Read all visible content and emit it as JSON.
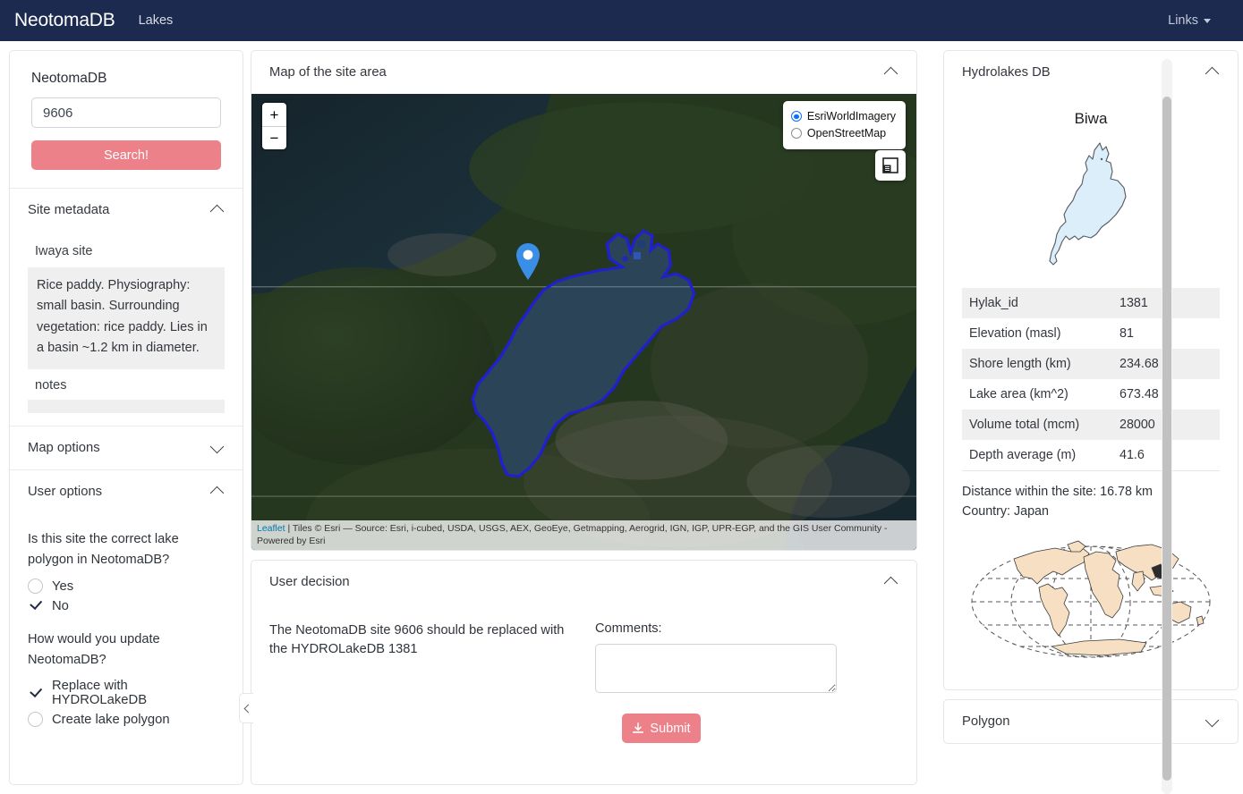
{
  "navbar": {
    "brand": "NeotomaDB",
    "nav_item": "Lakes",
    "links_label": "Links"
  },
  "sidebar": {
    "search": {
      "label": "NeotomaDB",
      "value": "9606",
      "placeholder": "",
      "button": "Search!"
    },
    "site_metadata": {
      "title": "Site metadata",
      "site_name": "Iwaya site",
      "description": "Rice paddy. Physiography: small basin. Surrounding vegetation: rice paddy. Lies in a basin ~1.2 km in diameter.",
      "notes_label": "notes",
      "notes_value": ""
    },
    "map_options": {
      "title": "Map options"
    },
    "user_options": {
      "title": "User options",
      "question1": "Is this site the correct lake polygon in NeotomaDB?",
      "options1": [
        {
          "label": "Yes",
          "selected": false
        },
        {
          "label": "No",
          "selected": true
        }
      ],
      "question2": "How would you update NeotomaDB?",
      "options2": [
        {
          "label": "Replace with HYDROLakeDB",
          "selected": true
        },
        {
          "label": "Create lake polygon",
          "selected": false
        }
      ]
    }
  },
  "map_panel": {
    "title": "Map of the site area",
    "zoom_in": "+",
    "zoom_out": "−",
    "layers": [
      {
        "label": "EsriWorldImagery",
        "selected": true
      },
      {
        "label": "OpenStreetMap",
        "selected": false
      }
    ],
    "attribution_link": "Leaflet",
    "attribution_text": " | Tiles © Esri — Source: Esri, i-cubed, USDA, USGS, AEX, GeoEye, Getmapping, Aerogrid, IGN, IGP, UPR-EGP, and the GIS User Community - Powered by Esri"
  },
  "decision_panel": {
    "title": "User decision",
    "statement": "The NeotomaDB site 9606 should be replaced with the HYDROLakeDB 1381",
    "comments_label": "Comments:",
    "comments_value": "",
    "comments_placeholder": "",
    "submit_label": "Submit"
  },
  "hydrolakes": {
    "title": "Hydrolakes DB",
    "lake_name": "Biwa",
    "properties": [
      {
        "key": "Hylak_id",
        "value": "1381"
      },
      {
        "key": "Elevation (masl)",
        "value": "81"
      },
      {
        "key": "Shore length (km)",
        "value": "234.68"
      },
      {
        "key": "Lake area (km^2)",
        "value": "673.48"
      },
      {
        "key": "Volume total (mcm)",
        "value": "28000"
      },
      {
        "key": "Depth average (m)",
        "value": "41.6"
      }
    ],
    "distance": "Distance within the site: 16.78 km",
    "country": "Country: Japan"
  },
  "polygon_panel": {
    "title": "Polygon"
  },
  "colors": {
    "navbar": "#1b2a4e",
    "accent": "#ed8189",
    "lake_fill": "#ddeefb",
    "globe_fill": "#f6dfc2",
    "polygon_stroke": "#2020d0",
    "marker": "#3a8ee6"
  }
}
